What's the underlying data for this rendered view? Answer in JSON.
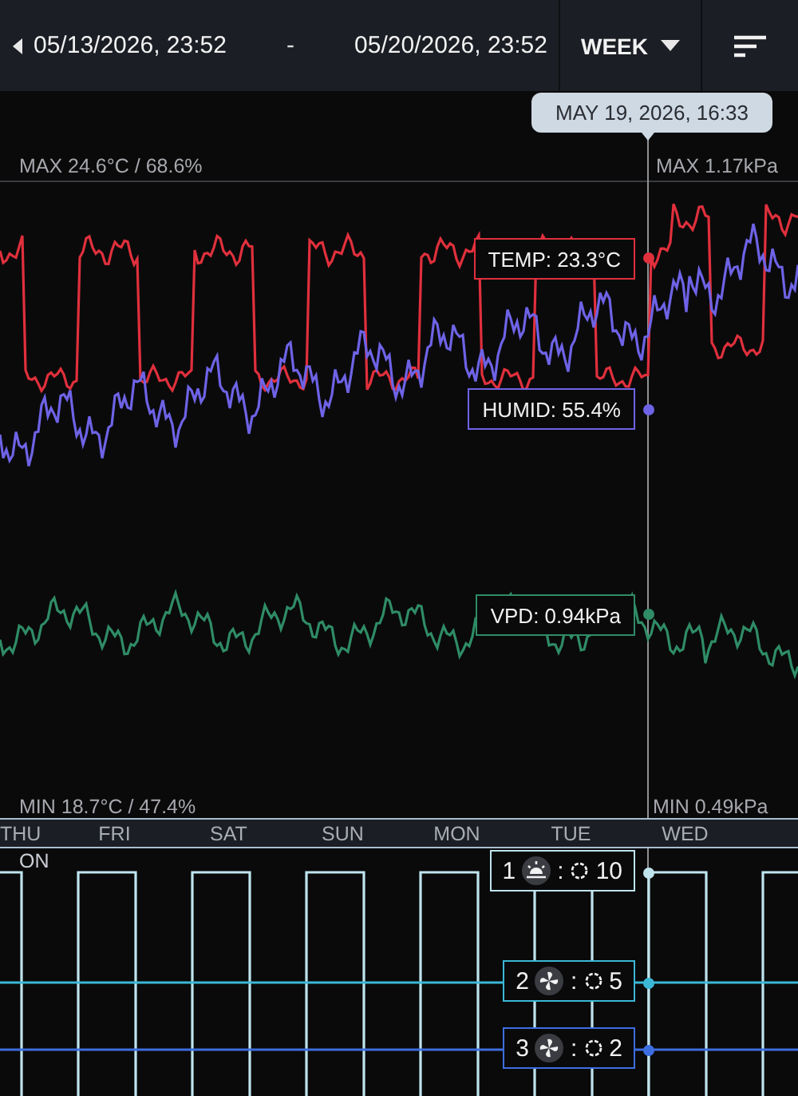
{
  "header": {
    "start": "05/13/2026, 23:52",
    "separator": "-",
    "end": "05/20/2026, 23:52",
    "range": "WEEK"
  },
  "chart": {
    "cursor_time": "MAY 19, 2026, 16:33",
    "max_left": "MAX 24.6°C / 68.6%",
    "max_right": "MAX 1.17kPa",
    "min_left": "MIN 18.7°C / 47.4%",
    "min_right": "MIN 0.49kPa",
    "readouts": [
      {
        "label": "TEMP: 23.3°C",
        "color": "#e0303c"
      },
      {
        "label": "HUMID: 55.4%",
        "color": "#6e63e6"
      },
      {
        "label": "VPD: 0.94kPa",
        "color": "#2f8c66"
      }
    ]
  },
  "days": [
    "THU",
    "FRI",
    "SAT",
    "SUN",
    "MON",
    "TUE",
    "WED"
  ],
  "devices": {
    "state_label": "ON",
    "items": [
      {
        "number": "1",
        "kind": "light",
        "separator": ":",
        "value": "10",
        "color": "#bfe4ee",
        "cycling": true
      },
      {
        "number": "2",
        "kind": "fan",
        "separator": ":",
        "value": "5",
        "color": "#3bb8d6",
        "cycling": false
      },
      {
        "number": "3",
        "kind": "fan",
        "separator": ":",
        "value": "2",
        "color": "#3d6ee0",
        "cycling": false
      }
    ]
  }
}
